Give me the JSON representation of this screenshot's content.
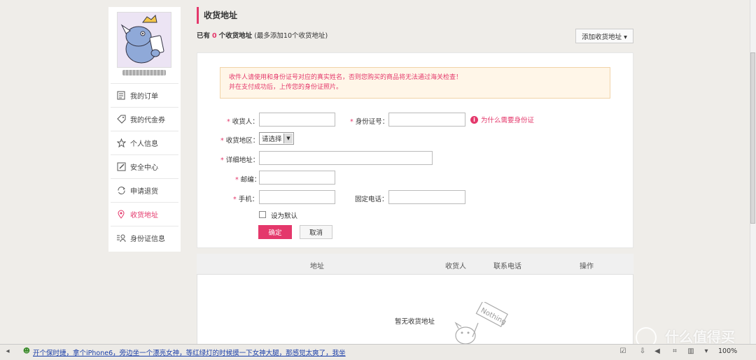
{
  "sidebar": {
    "items": [
      {
        "label": "我的订单",
        "icon": "order-icon"
      },
      {
        "label": "我的代金券",
        "icon": "coupon-icon"
      },
      {
        "label": "个人信息",
        "icon": "star-icon"
      },
      {
        "label": "安全中心",
        "icon": "edit-icon"
      },
      {
        "label": "申请退货",
        "icon": "refresh-icon"
      },
      {
        "label": "收货地址",
        "icon": "location-icon",
        "active": true
      },
      {
        "label": "身份证信息",
        "icon": "id-card-icon"
      }
    ]
  },
  "header": {
    "title": "收货地址",
    "count_prefix": "已有",
    "count_value": "0",
    "count_unit": "个收货地址",
    "count_note": "(最多添加10个收货地址)",
    "add_button": "添加收货地址 ▾"
  },
  "form": {
    "notice_line1": "收件人请使用和身份证号对应的真实姓名，否则您购买的商品将无法通过海关检查！",
    "notice_line2": "并在支付成功后，上传您的身份证照片。",
    "receiver_label": "收货人：",
    "id_label": "身份证号：",
    "id_help": "为什么需要身份证",
    "region_label": "收货地区：",
    "region_value": "请选择",
    "address_label": "详细地址：",
    "zip_label": "邮编：",
    "mobile_label": "手机：",
    "phone_label": "固定电话：",
    "default_label": "设为默认",
    "confirm": "确定",
    "cancel": "取消",
    "required_mark": "*"
  },
  "table": {
    "headers": [
      "地址",
      "收货人",
      "联系电话",
      "操作"
    ],
    "empty": "暂无收货地址"
  },
  "statusbar": {
    "link": "开个保时捷，拿个iPhone6，旁边坐一个漂亮女神，等红绿灯的时候摸一下女神大腿，那感觉太爽了，我坐",
    "zoom": "100%"
  },
  "watermark": "什么值得买",
  "colors": {
    "accent": "#e4386b",
    "background": "#efede9"
  }
}
